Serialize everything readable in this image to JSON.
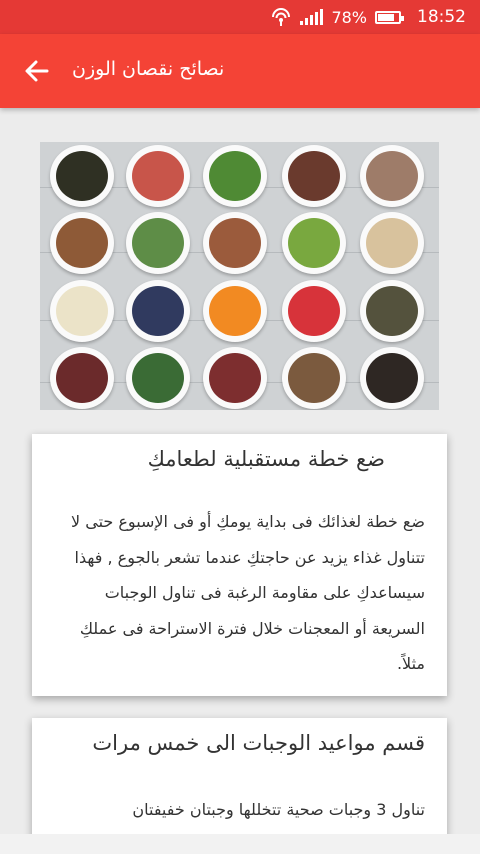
{
  "status_bar": {
    "battery_percent": "78%",
    "time": "18:52",
    "icons": [
      "hotspot-icon",
      "signal-icon",
      "battery-icon"
    ],
    "battery_level": 0.78
  },
  "app_bar": {
    "title": "نصائح نقصان الوزن",
    "back_icon": "arrow-left-icon",
    "color": "#f44336"
  },
  "hero_image": {
    "subject": "bowls of healthy foods"
  },
  "cards": [
    {
      "title": "ضع خطة مستقبلية لطعامكِ",
      "body": "ضع خطة لغذائك فى بداية يومكِ أو فى الإسبوع حتى لا تتناول غذاء يزيد عن حاجتكِ عندما تشعر بالجوع , فهذا سيساعدكِ على مقاومة الرغبة فى تناول الوجبات السريعة أو المعجنات خلال فترة الاستراحة فى عملكِ مثلاً."
    },
    {
      "title": "قسم مواعيد الوجبات الى خمس مرات",
      "body": "تناول 3 وجبات صحية تتخللها وجبتان خفيفتان"
    }
  ]
}
